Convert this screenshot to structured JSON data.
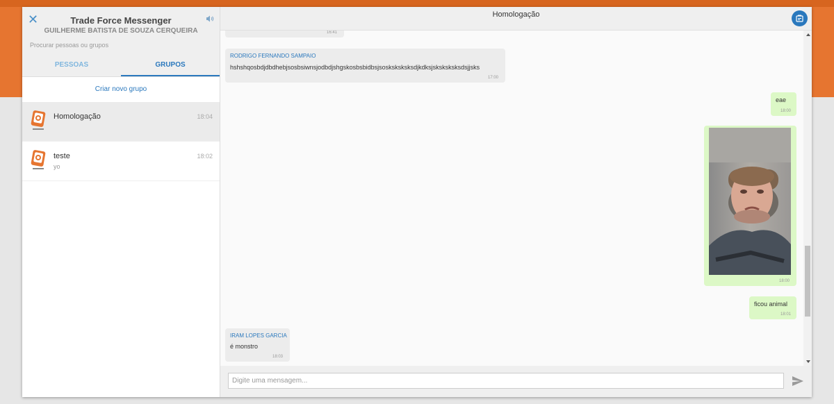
{
  "sidebar": {
    "title": "Trade Force Messenger",
    "user": "GUILHERME BATISTA DE SOUZA CERQUEIRA",
    "search_placeholder": "Procurar pessoas ou grupos",
    "tabs": [
      {
        "label": "PESSOAS",
        "active": false
      },
      {
        "label": "GRUPOS",
        "active": true
      }
    ],
    "create_group_label": "Criar novo grupo",
    "groups": [
      {
        "name": "Homologação",
        "time": "18:04",
        "last": "",
        "selected": true
      },
      {
        "name": "teste",
        "time": "18:02",
        "last": "yo",
        "selected": false
      }
    ]
  },
  "chat": {
    "title": "Homologação",
    "messages": [
      {
        "direction": "in",
        "sender": "",
        "text": "",
        "time": "16:41"
      },
      {
        "direction": "in",
        "sender": "RODRIGO FERNANDO SAMPAIO",
        "text": "hshshqosbdjdbdhebjsosbsiwnsjodbdjshgskosbsbidbsjsosksksksksdjkdksjsksksksksdsjjsks",
        "time": "17:00"
      },
      {
        "direction": "out",
        "sender": "",
        "text": "eae",
        "time": "18:00"
      },
      {
        "direction": "out",
        "sender": "",
        "text": "",
        "time": "18:00",
        "kind": "image"
      },
      {
        "direction": "out",
        "sender": "",
        "text": "ficou animal",
        "time": "18:01"
      },
      {
        "direction": "in",
        "sender": "IRAM LOPES GARCIA",
        "text": "é monstro",
        "time": "18:03"
      }
    ],
    "composer_placeholder": "Digite uma mensagem..."
  },
  "colors": {
    "accent": "#2a78bd",
    "brand_orange": "#e67530",
    "outgoing_bubble": "#dcf8c6",
    "incoming_bubble": "#ececec"
  },
  "icons": [
    "close-icon",
    "speaker-icon",
    "group-logo-icon",
    "info-icon",
    "send-icon"
  ]
}
